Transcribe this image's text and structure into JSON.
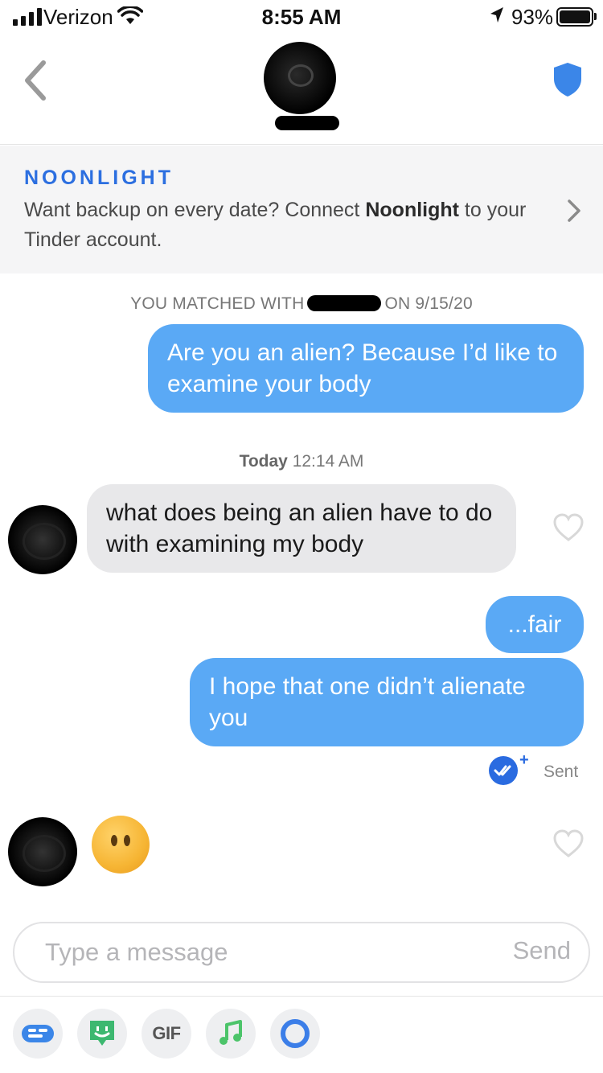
{
  "status_bar": {
    "carrier": "Verizon",
    "time": "8:55 AM",
    "battery": "93%"
  },
  "banner": {
    "brand": "NOONLIGHT",
    "text_prefix": "Want backup on every date? Connect ",
    "text_bold": "Noonlight",
    "text_suffix": " to your Tinder account."
  },
  "conversation": {
    "match_prefix": "YOU MATCHED WITH",
    "match_suffix": "ON 9/15/20",
    "day_label": "Today",
    "day_time": "12:14 AM",
    "messages": [
      {
        "from": "me",
        "text": "Are you an alien? Because I’d like to examine your body"
      },
      {
        "from": "them",
        "text": "what does being an alien have to do with examining my body"
      },
      {
        "from": "me",
        "text": "...fair"
      },
      {
        "from": "me",
        "text": "I hope that one didn’t alienate you"
      },
      {
        "from": "them",
        "emoji": "face-without-mouth"
      }
    ],
    "sent_status": "Sent"
  },
  "composer": {
    "placeholder": "Type a message",
    "send_label": "Send"
  },
  "toolbar": {
    "gif_label": "GIF",
    "icons": [
      "chat-bubble-icon",
      "sticker-icon",
      "gif-icon",
      "music-icon",
      "ring-icon"
    ]
  },
  "colors": {
    "outgoing_bubble": "#5aa9f5",
    "incoming_bubble": "#e8e8ea",
    "accent_blue": "#2a6be0",
    "shield_blue": "#3b86e8"
  }
}
